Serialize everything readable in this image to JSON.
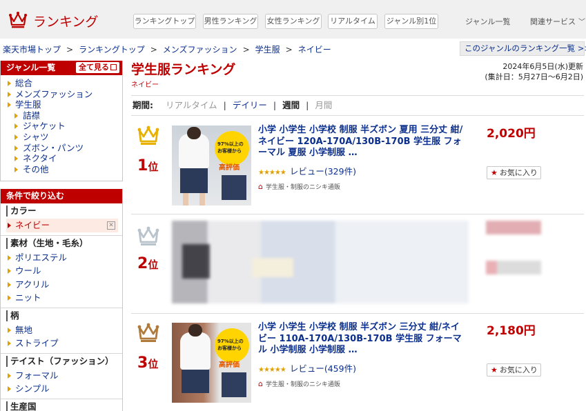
{
  "header": {
    "logo_text": "ランキング",
    "nav": [
      "ランキングトップ",
      "男性ランキング",
      "女性ランキング",
      "リアルタイム",
      "ジャンル別1位"
    ],
    "genre_list": "ジャンル一覧",
    "related": "関連サービス"
  },
  "breadcrumb": {
    "items": [
      "楽天市場トップ",
      "ランキングトップ",
      "メンズファッション",
      "学生服",
      "ネイビー"
    ],
    "separator": ">",
    "genre_ranking_link": "このジャンルのランキング一覧 >>"
  },
  "sidebar": {
    "genre_head": "ジャンル一覧",
    "see_all": "全て見る",
    "genres": [
      {
        "label": "総合",
        "level": 0
      },
      {
        "label": "メンズファッション",
        "level": 0
      },
      {
        "label": "学生服",
        "level": 0
      },
      {
        "label": "詰襟",
        "level": 1
      },
      {
        "label": "ジャケット",
        "level": 1
      },
      {
        "label": "シャツ",
        "level": 1
      },
      {
        "label": "ズボン・パンツ",
        "level": 1
      },
      {
        "label": "ネクタイ",
        "level": 1
      },
      {
        "label": "その他",
        "level": 1
      }
    ],
    "filter_head": "条件で絞り込む",
    "filters": [
      {
        "title": "カラー",
        "items": [
          "ネイビー"
        ],
        "selected": "ネイビー"
      },
      {
        "title": "素材（生地・毛糸）",
        "items": [
          "ポリエステル",
          "ウール",
          "アクリル",
          "ニット"
        ]
      },
      {
        "title": "柄",
        "items": [
          "無地",
          "ストライプ"
        ]
      },
      {
        "title": "テイスト（ファッション）",
        "items": [
          "フォーマル",
          "シンプル"
        ]
      },
      {
        "title": "生産国",
        "items": []
      }
    ]
  },
  "main": {
    "title": "学生服ランキング",
    "subtitle": "ネイビー",
    "updated_line1": "2024年6月5日(水)更新",
    "updated_line2": "(集計日：5月27日～6月2日)",
    "period_label": "期間:",
    "periods": [
      {
        "label": "リアルタイム",
        "state": "disabled"
      },
      {
        "label": "デイリー",
        "state": "link"
      },
      {
        "label": "週間",
        "state": "active"
      },
      {
        "label": "月間",
        "state": "disabled"
      }
    ]
  },
  "items": [
    {
      "rank": "1",
      "rank_suffix": "位",
      "crown_color": "#e8b100",
      "title": "小学 小学生 小学校 制服 半ズボン 夏用 三分丈 紺/ネイビー 120A-170A/130B-170B 学生服 フォーマル 夏服 小学制服 …",
      "stars": "★★★★★",
      "review": "レビュー(329件)",
      "shop": "学生服・制服のニシキ通販",
      "price": "2,020円",
      "fav": "お気に入り",
      "thumb_badge_top": "97%以上の",
      "thumb_badge_mid": "お客様から",
      "thumb_badge_bottom": "高評価"
    },
    {
      "rank": "2",
      "rank_suffix": "位",
      "crown_color": "#b9c3cc"
    },
    {
      "rank": "3",
      "rank_suffix": "位",
      "crown_color": "#b07a3a",
      "title": "小学 小学生 小学校 制服 半ズボン 三分丈 紺/ネイビー 110A-170A/130B-170B 学生服 フォーマル 小学制服 小学制服 …",
      "stars": "★★★★★",
      "review": "レビュー(459件)",
      "shop": "学生服・制服のニシキ通販",
      "price": "2,180円",
      "fav": "お気に入り",
      "thumb_badge_top": "97%以上の",
      "thumb_badge_mid": "お客様から",
      "thumb_badge_bottom": "高評価"
    }
  ],
  "colors": {
    "brand": "#bf0000",
    "link": "#0b2f8c",
    "accent": "#e0a100"
  }
}
